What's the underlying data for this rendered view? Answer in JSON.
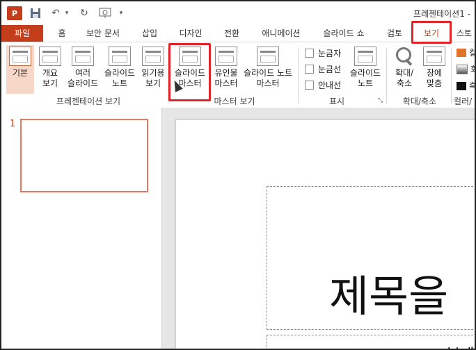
{
  "window": {
    "title": "프레젠테이션1 -"
  },
  "quick_access": {
    "app_icon": "P"
  },
  "tabs": [
    "파일",
    "홈",
    "보안 문서",
    "삽입",
    "디자인",
    "전환",
    "애니메이션",
    "슬라이드 쇼",
    "검토",
    "보기",
    "스토"
  ],
  "active_tab": "보기",
  "ribbon": {
    "presentation_views": {
      "label": "프레젠테이션 보기",
      "buttons": [
        {
          "line1": "기본",
          "line2": ""
        },
        {
          "line1": "개요",
          "line2": "보기"
        },
        {
          "line1": "여러",
          "line2": "슬라이드"
        },
        {
          "line1": "슬라이드",
          "line2": "노트"
        },
        {
          "line1": "읽기용",
          "line2": "보기"
        }
      ]
    },
    "master_views": {
      "label": "마스터 보기",
      "buttons": [
        {
          "line1": "슬라이드",
          "line2": "마스터"
        },
        {
          "line1": "유인물",
          "line2": "마스터"
        },
        {
          "line1": "슬라이드 노트",
          "line2": "마스터"
        }
      ]
    },
    "show": {
      "label": "표시",
      "checkboxes": [
        "눈금자",
        "눈금선",
        "안내선"
      ],
      "notes_button": {
        "line1": "슬라이드",
        "line2": "노트"
      },
      "launcher": "⤡"
    },
    "zoom": {
      "label": "확대/축소",
      "buttons": [
        {
          "line1": "확대/",
          "line2": "축소"
        },
        {
          "line1": "창에",
          "line2": "맞춤"
        }
      ]
    },
    "color": {
      "label": "컬러/",
      "items": [
        "컬",
        "회",
        "흑"
      ],
      "colors": [
        "#e0742a",
        "#8a8a8a",
        "#111111"
      ]
    }
  },
  "slides_pane": {
    "slide_number": "1"
  },
  "slide": {
    "title": "제목을",
    "subtitle": "부제"
  },
  "colors": {
    "accent": "#c43e1c",
    "highlight": "#e0242a"
  }
}
